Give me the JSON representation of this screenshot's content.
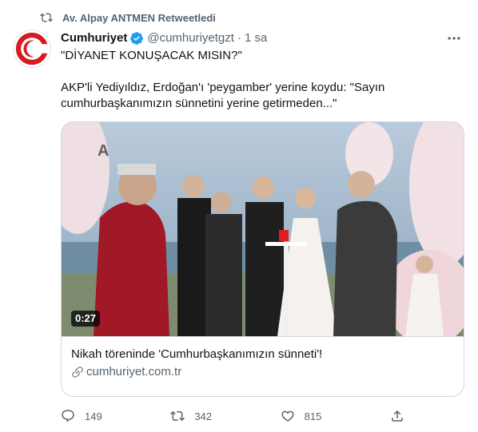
{
  "retweet": {
    "label": "Av. Alpay ANTMEN Retweetledi"
  },
  "tweet": {
    "author_name": "Cumhuriyet",
    "handle": "@cumhuriyetgzt",
    "separator": "·",
    "time": "1 sa",
    "text_line1": "\"DİYANET KONUŞACAK MISIN?\"",
    "text_line2": "AKP'li Yediyıldız, Erdoğan'ı 'peygamber' yerine koydu: \"Sayın",
    "text_line3": "cumhurbaşkanımızın sünnetini yerine getirmeden...\""
  },
  "card": {
    "video_duration": "0:27",
    "title": "Nikah töreninde 'Cumhurbaşkanımızın sünneti'!",
    "domain": "cumhuriyet.com.tr"
  },
  "actions": {
    "reply_count": "149",
    "retweet_count": "342",
    "like_count": "815"
  },
  "colors": {
    "text_primary": "#0f1419",
    "text_secondary": "#536471",
    "verified_blue": "#1d9bf0",
    "border": "#cfd9de",
    "brand_red": "#d71920"
  },
  "icons": [
    "retweet-icon",
    "verified-badge-icon",
    "more-icon",
    "link-icon",
    "reply-icon",
    "like-icon",
    "share-icon"
  ]
}
